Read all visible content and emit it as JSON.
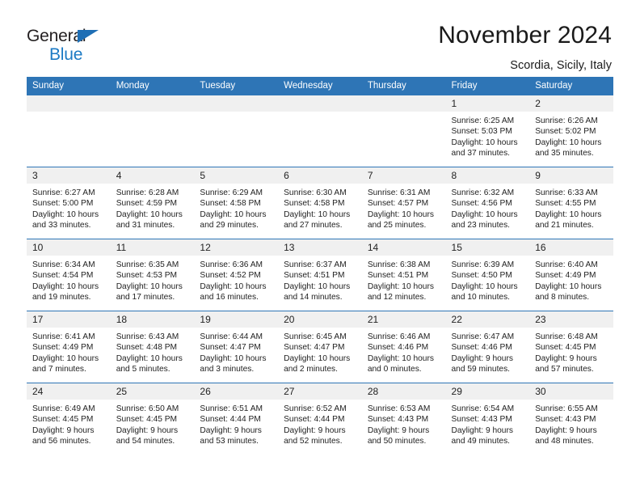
{
  "brand": {
    "line1": "General",
    "line2": "Blue",
    "triangle_color": "#1f6fb5",
    "blue_text_color": "#1c7ac4"
  },
  "header": {
    "month_title": "November 2024",
    "location": "Scordia, Sicily, Italy"
  },
  "theme": {
    "header_bar_color": "#2e75b6",
    "daynum_band_color": "#f0f0f0",
    "row_rule_color": "#2e75b6",
    "text_color": "#222222"
  },
  "weekdays": [
    "Sunday",
    "Monday",
    "Tuesday",
    "Wednesday",
    "Thursday",
    "Friday",
    "Saturday"
  ],
  "labels": {
    "sunrise_prefix": "Sunrise:",
    "sunset_prefix": "Sunset:",
    "daylight_prefix": "Daylight:"
  },
  "weeks": [
    [
      {
        "day": "",
        "empty": true
      },
      {
        "day": "",
        "empty": true
      },
      {
        "day": "",
        "empty": true
      },
      {
        "day": "",
        "empty": true
      },
      {
        "day": "",
        "empty": true
      },
      {
        "day": "1",
        "sunrise": "Sunrise: 6:25 AM",
        "sunset": "Sunset: 5:03 PM",
        "daylight_1": "Daylight: 10 hours",
        "daylight_2": "and 37 minutes."
      },
      {
        "day": "2",
        "sunrise": "Sunrise: 6:26 AM",
        "sunset": "Sunset: 5:02 PM",
        "daylight_1": "Daylight: 10 hours",
        "daylight_2": "and 35 minutes."
      }
    ],
    [
      {
        "day": "3",
        "sunrise": "Sunrise: 6:27 AM",
        "sunset": "Sunset: 5:00 PM",
        "daylight_1": "Daylight: 10 hours",
        "daylight_2": "and 33 minutes."
      },
      {
        "day": "4",
        "sunrise": "Sunrise: 6:28 AM",
        "sunset": "Sunset: 4:59 PM",
        "daylight_1": "Daylight: 10 hours",
        "daylight_2": "and 31 minutes."
      },
      {
        "day": "5",
        "sunrise": "Sunrise: 6:29 AM",
        "sunset": "Sunset: 4:58 PM",
        "daylight_1": "Daylight: 10 hours",
        "daylight_2": "and 29 minutes."
      },
      {
        "day": "6",
        "sunrise": "Sunrise: 6:30 AM",
        "sunset": "Sunset: 4:58 PM",
        "daylight_1": "Daylight: 10 hours",
        "daylight_2": "and 27 minutes."
      },
      {
        "day": "7",
        "sunrise": "Sunrise: 6:31 AM",
        "sunset": "Sunset: 4:57 PM",
        "daylight_1": "Daylight: 10 hours",
        "daylight_2": "and 25 minutes."
      },
      {
        "day": "8",
        "sunrise": "Sunrise: 6:32 AM",
        "sunset": "Sunset: 4:56 PM",
        "daylight_1": "Daylight: 10 hours",
        "daylight_2": "and 23 minutes."
      },
      {
        "day": "9",
        "sunrise": "Sunrise: 6:33 AM",
        "sunset": "Sunset: 4:55 PM",
        "daylight_1": "Daylight: 10 hours",
        "daylight_2": "and 21 minutes."
      }
    ],
    [
      {
        "day": "10",
        "sunrise": "Sunrise: 6:34 AM",
        "sunset": "Sunset: 4:54 PM",
        "daylight_1": "Daylight: 10 hours",
        "daylight_2": "and 19 minutes."
      },
      {
        "day": "11",
        "sunrise": "Sunrise: 6:35 AM",
        "sunset": "Sunset: 4:53 PM",
        "daylight_1": "Daylight: 10 hours",
        "daylight_2": "and 17 minutes."
      },
      {
        "day": "12",
        "sunrise": "Sunrise: 6:36 AM",
        "sunset": "Sunset: 4:52 PM",
        "daylight_1": "Daylight: 10 hours",
        "daylight_2": "and 16 minutes."
      },
      {
        "day": "13",
        "sunrise": "Sunrise: 6:37 AM",
        "sunset": "Sunset: 4:51 PM",
        "daylight_1": "Daylight: 10 hours",
        "daylight_2": "and 14 minutes."
      },
      {
        "day": "14",
        "sunrise": "Sunrise: 6:38 AM",
        "sunset": "Sunset: 4:51 PM",
        "daylight_1": "Daylight: 10 hours",
        "daylight_2": "and 12 minutes."
      },
      {
        "day": "15",
        "sunrise": "Sunrise: 6:39 AM",
        "sunset": "Sunset: 4:50 PM",
        "daylight_1": "Daylight: 10 hours",
        "daylight_2": "and 10 minutes."
      },
      {
        "day": "16",
        "sunrise": "Sunrise: 6:40 AM",
        "sunset": "Sunset: 4:49 PM",
        "daylight_1": "Daylight: 10 hours",
        "daylight_2": "and 8 minutes."
      }
    ],
    [
      {
        "day": "17",
        "sunrise": "Sunrise: 6:41 AM",
        "sunset": "Sunset: 4:49 PM",
        "daylight_1": "Daylight: 10 hours",
        "daylight_2": "and 7 minutes."
      },
      {
        "day": "18",
        "sunrise": "Sunrise: 6:43 AM",
        "sunset": "Sunset: 4:48 PM",
        "daylight_1": "Daylight: 10 hours",
        "daylight_2": "and 5 minutes."
      },
      {
        "day": "19",
        "sunrise": "Sunrise: 6:44 AM",
        "sunset": "Sunset: 4:47 PM",
        "daylight_1": "Daylight: 10 hours",
        "daylight_2": "and 3 minutes."
      },
      {
        "day": "20",
        "sunrise": "Sunrise: 6:45 AM",
        "sunset": "Sunset: 4:47 PM",
        "daylight_1": "Daylight: 10 hours",
        "daylight_2": "and 2 minutes."
      },
      {
        "day": "21",
        "sunrise": "Sunrise: 6:46 AM",
        "sunset": "Sunset: 4:46 PM",
        "daylight_1": "Daylight: 10 hours",
        "daylight_2": "and 0 minutes."
      },
      {
        "day": "22",
        "sunrise": "Sunrise: 6:47 AM",
        "sunset": "Sunset: 4:46 PM",
        "daylight_1": "Daylight: 9 hours",
        "daylight_2": "and 59 minutes."
      },
      {
        "day": "23",
        "sunrise": "Sunrise: 6:48 AM",
        "sunset": "Sunset: 4:45 PM",
        "daylight_1": "Daylight: 9 hours",
        "daylight_2": "and 57 minutes."
      }
    ],
    [
      {
        "day": "24",
        "sunrise": "Sunrise: 6:49 AM",
        "sunset": "Sunset: 4:45 PM",
        "daylight_1": "Daylight: 9 hours",
        "daylight_2": "and 56 minutes."
      },
      {
        "day": "25",
        "sunrise": "Sunrise: 6:50 AM",
        "sunset": "Sunset: 4:45 PM",
        "daylight_1": "Daylight: 9 hours",
        "daylight_2": "and 54 minutes."
      },
      {
        "day": "26",
        "sunrise": "Sunrise: 6:51 AM",
        "sunset": "Sunset: 4:44 PM",
        "daylight_1": "Daylight: 9 hours",
        "daylight_2": "and 53 minutes."
      },
      {
        "day": "27",
        "sunrise": "Sunrise: 6:52 AM",
        "sunset": "Sunset: 4:44 PM",
        "daylight_1": "Daylight: 9 hours",
        "daylight_2": "and 52 minutes."
      },
      {
        "day": "28",
        "sunrise": "Sunrise: 6:53 AM",
        "sunset": "Sunset: 4:43 PM",
        "daylight_1": "Daylight: 9 hours",
        "daylight_2": "and 50 minutes."
      },
      {
        "day": "29",
        "sunrise": "Sunrise: 6:54 AM",
        "sunset": "Sunset: 4:43 PM",
        "daylight_1": "Daylight: 9 hours",
        "daylight_2": "and 49 minutes."
      },
      {
        "day": "30",
        "sunrise": "Sunrise: 6:55 AM",
        "sunset": "Sunset: 4:43 PM",
        "daylight_1": "Daylight: 9 hours",
        "daylight_2": "and 48 minutes."
      }
    ]
  ]
}
